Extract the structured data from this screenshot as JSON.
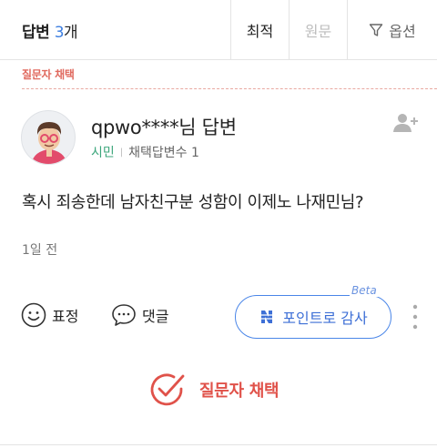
{
  "header": {
    "answers_label": "답변",
    "answers_count": "3",
    "answers_unit": "개",
    "sort_latest": "최적",
    "sort_original": "원문",
    "filter_label": "옵션"
  },
  "answer": {
    "adopt_section_label": "질문자 채택",
    "author_title": "qpwo****님 답변",
    "grade": "시민",
    "adopted_count_label": "채택답변수 1",
    "content": "혹시 죄송한데 남자친구분 성함이 이제노 나재민님?",
    "time_ago": "1일 전"
  },
  "actions": {
    "expression_label": "표정",
    "comment_label": "댓글",
    "point_thanks_label": "포인트로 감사",
    "beta_label": "Beta",
    "adopt_button_label": "질문자 채택"
  },
  "colors": {
    "accent_blue": "#3d7ee0",
    "adopt_red": "#e0524a",
    "grade_green": "#3aa57a"
  },
  "icons": [
    "avatar",
    "add-friend-icon",
    "filter-icon",
    "smile-icon",
    "comment-icon",
    "n-point-icon",
    "more-icon",
    "adopt-check-icon"
  ]
}
